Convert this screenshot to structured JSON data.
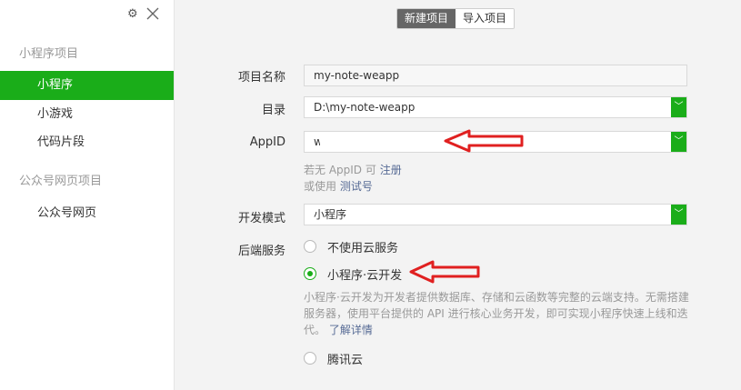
{
  "sidebar": {
    "icons": {
      "settings": "gear-icon",
      "close": "close-icon"
    },
    "sections": [
      {
        "title": "小程序项目",
        "items": [
          "小程序",
          "小游戏",
          "代码片段"
        ]
      },
      {
        "title": "公众号网页项目",
        "items": [
          "公众号网页"
        ]
      }
    ],
    "active_item": "小程序"
  },
  "tabs": {
    "new_label": "新建项目",
    "import_label": "导入项目",
    "active": "新建项目"
  },
  "form": {
    "project_name_label": "项目名称",
    "project_name_value": "my-note-weapp",
    "directory_label": "目录",
    "directory_value": "D:\\my-note-weapp",
    "appid_label": "AppID",
    "appid_value": "w",
    "no_appid_prefix": "若无 AppID 可",
    "register_link": "注册",
    "or_use_prefix": "或使用",
    "test_account_link": "测试号",
    "dev_mode_label": "开发模式",
    "dev_mode_value": "小程序",
    "backend_label": "后端服务",
    "backend_options": [
      "不使用云服务",
      "小程序·云开发",
      "腾讯云"
    ],
    "backend_selected": "小程序·云开发",
    "cloud_desc": "小程序·云开发为开发者提供数据库、存储和云函数等完整的云端支持。无需搭建服务器，使用平台提供的 API 进行核心业务开发，即可实现小程序快速上线和迭代。",
    "learn_more_link": "了解详情"
  },
  "colors": {
    "accent": "#1aad19",
    "link": "#576b95",
    "annotation": "#e02020"
  }
}
